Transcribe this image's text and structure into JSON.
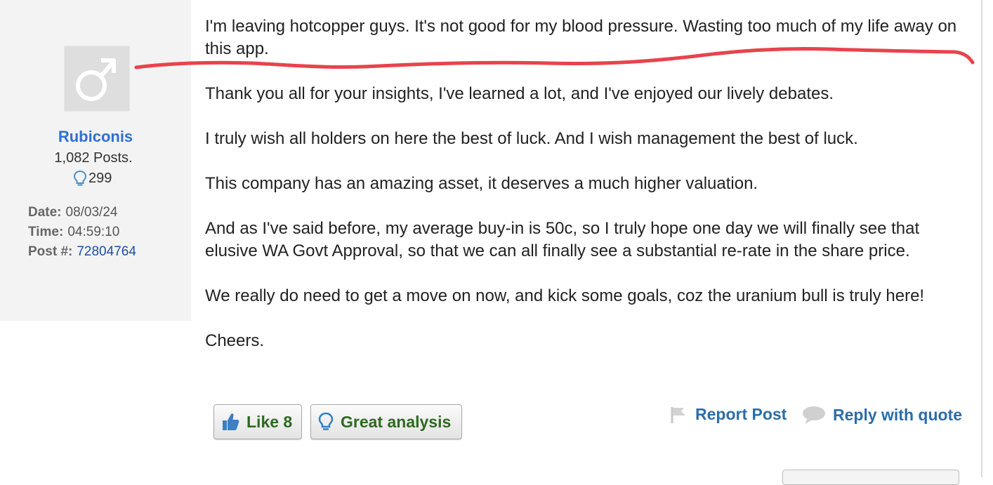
{
  "user": {
    "name": "Rubiconis",
    "posts": "1,082 Posts.",
    "likes": "299",
    "avatar_icon": "male-symbol-icon"
  },
  "meta": {
    "date_label": "Date:",
    "date_value": "08/03/24",
    "time_label": "Time:",
    "time_value": "04:59:10",
    "post_label": "Post #:",
    "post_value": "72804764"
  },
  "post": {
    "paragraphs": [
      "I'm leaving hotcopper guys. It's not good for my blood pressure. Wasting too much of my life away on this app.",
      "Thank you all for your insights, I've learned a lot, and I've enjoyed our lively debates.",
      "I truly wish all holders on here the best of luck. And I wish management the best of luck.",
      "This company has an amazing asset, it deserves a much higher valuation.",
      "And as I've said before, my average buy-in is 50c, so I truly hope one day we will finally see that elusive WA Govt Approval, so that we can all finally see a substantial re-rate in the share price.",
      "We really do need to get a move on now, and kick some goals, coz the uranium bull is truly here!",
      "Cheers."
    ]
  },
  "actions": {
    "like_label": "Like 8",
    "great_analysis_label": "Great analysis",
    "report_label": "Report Post",
    "reply_label": "Reply with quote"
  },
  "colors": {
    "username": "#2f6fd6",
    "button_text": "#2d6a1f",
    "action_link": "#2b6da8",
    "annotation": "#e8434c"
  }
}
